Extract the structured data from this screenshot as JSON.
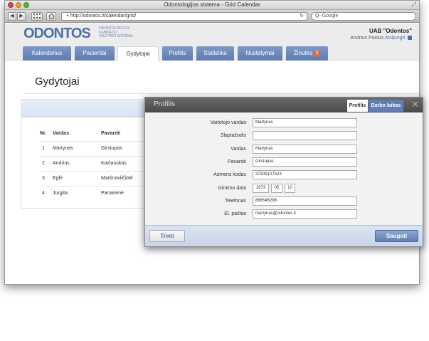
{
  "window": {
    "title": "Odontologijos sistema - Grid Calendar"
  },
  "browser": {
    "back_icon": "◀",
    "forward_icon": "▶",
    "url": "+ http://odontos.lt/calendar/grid/",
    "reload_icon": "↻",
    "search_placeholder": "Q- Google"
  },
  "header": {
    "logo": "ODONTOS",
    "logo_sub_1": "ODONTOLOGIJOS",
    "logo_sub_2": "KABINETŲ",
    "logo_sub_3": "VALDYMO SISTEMA",
    "company": "UAB \"Odontos\"",
    "user_name": "Andrius Pocius",
    "logout": "Atsijungti"
  },
  "tabs": [
    {
      "label": "Kalendorius"
    },
    {
      "label": "Pacientai"
    },
    {
      "label": "Gydytojai"
    },
    {
      "label": "Profilis"
    },
    {
      "label": "Statistika"
    },
    {
      "label": "Nustatymai"
    },
    {
      "label": "Žinutės",
      "badge": "0"
    }
  ],
  "page": {
    "title": "Gydytojai"
  },
  "table": {
    "headers": [
      "Nr.",
      "Vardas",
      "Pavardė"
    ],
    "rows": [
      [
        "1",
        "Martynas",
        "Girstupas"
      ],
      [
        "2",
        "Andrius",
        "Kazlauskas"
      ],
      [
        "3",
        "Eglė",
        "Martinaviičiūtė"
      ],
      [
        "4",
        "Jurgita",
        "Panarienė"
      ]
    ]
  },
  "modal": {
    "title": "Profilis",
    "tab_profilis": "Profilis",
    "tab_darbo": "Darbo laikas",
    "close_icon": "✕",
    "fields": [
      {
        "label": "Vartotojo vardas",
        "value": "Martynas"
      },
      {
        "label": "Slaptažodis",
        "value": ""
      },
      {
        "label": "Vardas",
        "value": "Martynas"
      },
      {
        "label": "Pavardė",
        "value": "Girstupas"
      },
      {
        "label": "Asmens kodas",
        "value": "37305107523"
      },
      {
        "label": "Gimimo data",
        "value": ""
      },
      {
        "label": "Telefonas",
        "value": "868546298"
      },
      {
        "label": "El. paštas",
        "value": "martynas@odontos.lt"
      }
    ],
    "birth_year": "1973",
    "birth_month": "05",
    "birth_day": "10",
    "delete_label": "Trinti",
    "save_label": "Saugoti"
  }
}
